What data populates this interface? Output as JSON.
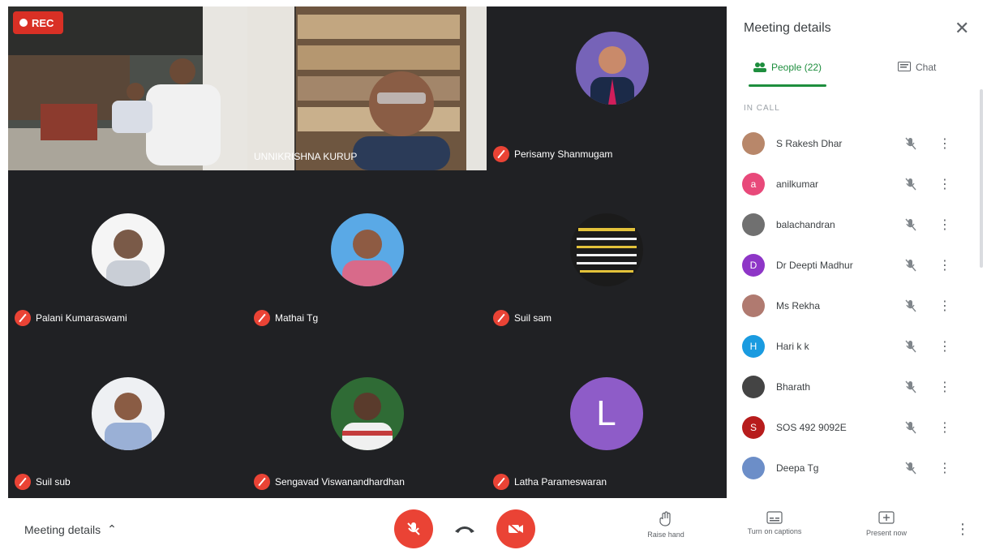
{
  "tiles": [
    {
      "name": "",
      "recording_label": "REC"
    },
    {
      "name": "UNNIKRISHNA KURUP"
    },
    {
      "name": "Perisamy Shanmugam"
    },
    {
      "name": "Palani Kumaraswami"
    },
    {
      "name": "Mathai Tg"
    },
    {
      "name": "Suil sam"
    },
    {
      "name": "Suil sub"
    },
    {
      "name": "Sengavad Viswanandhardhan"
    },
    {
      "name": "Latha Parameswaran",
      "letter": "L"
    }
  ],
  "panel": {
    "title": "Meeting details",
    "tab_people": "People (22)",
    "tab_chat": "Chat",
    "section_label": "IN CALL",
    "participants": [
      {
        "name": "S Rakesh Dhar",
        "color": "#b8876a"
      },
      {
        "name": "anilkumar",
        "color": "#e8497a",
        "initial": "a"
      },
      {
        "name": "balachandran",
        "color": "#707070"
      },
      {
        "name": "Dr Deepti Madhur",
        "color": "#8e36c7",
        "initial": "D"
      },
      {
        "name": "Ms Rekha",
        "color": "#b07a70"
      },
      {
        "name": "Hari k k",
        "color": "#1a9be0",
        "initial": "H"
      },
      {
        "name": "Bharath",
        "color": "#444444"
      },
      {
        "name": "SOS 492 9092E",
        "color": "#b71c1c",
        "initial": "S"
      },
      {
        "name": "Deepa Tg",
        "color": "#6c8ec8"
      }
    ]
  },
  "bottom": {
    "meeting_details_label": "Meeting details",
    "raise_hand_label": "Raise hand",
    "turn_on_captions_label": "Turn on captions",
    "present_now_label": "Present now"
  },
  "colors": {
    "accent_green": "#1e8e3e",
    "danger_red": "#ea4335",
    "grid_bg": "#202124"
  }
}
